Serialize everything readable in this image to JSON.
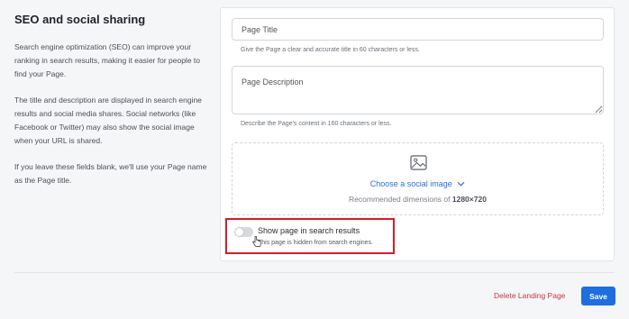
{
  "section": {
    "title": "SEO and social sharing",
    "paragraphs": [
      "Search engine optimization (SEO) can improve your ranking in search results, making it easier for people to find your Page.",
      "The title and description are displayed in search engine results and social media shares. Social networks (like Facebook or Twitter) may also show the social image when your URL is shared.",
      "If you leave these fields blank, we'll use your Page name as the Page title."
    ]
  },
  "form": {
    "title_placeholder": "Page Title",
    "title_value": "",
    "title_helper": "Give the Page a clear and accurate title in 60 characters or less.",
    "description_placeholder": "Page Description",
    "description_value": "",
    "description_helper": "Describe the Page's content in 160 characters or less.",
    "image": {
      "choose_label": "Choose a social image",
      "recommend_prefix": "Recommended dimensions of",
      "recommend_size": "1280×720"
    },
    "search_toggle": {
      "label": "Show page in search results",
      "enabled": false,
      "helper": "This page is hidden from search engines."
    }
  },
  "footer": {
    "delete_label": "Delete Landing Page",
    "save_label": "Save"
  },
  "colors": {
    "accent": "#1f6ee0",
    "link": "#2d6fd6",
    "danger": "#c8363d",
    "highlight": "#d01f2a"
  }
}
